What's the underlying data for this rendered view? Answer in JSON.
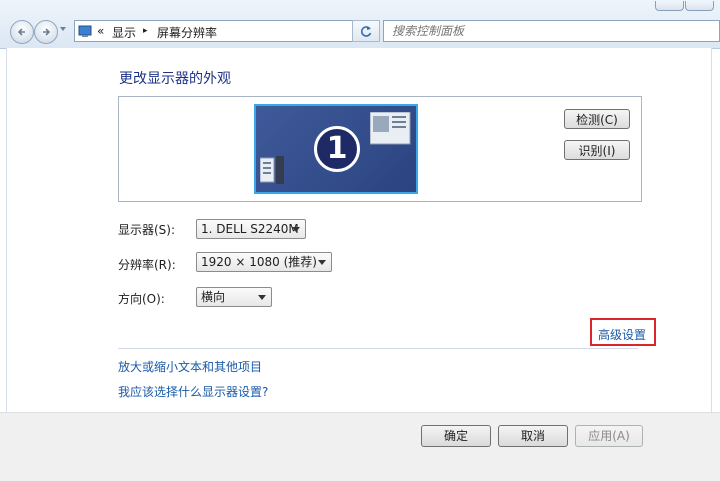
{
  "address_bar": {
    "overflow": "«",
    "crumbs": [
      "显示",
      "屏幕分辨率"
    ],
    "separator": "▸"
  },
  "search": {
    "placeholder": "搜索控制面板"
  },
  "main": {
    "title": "更改显示器的外观",
    "monitor_number": "1",
    "detect_button": "检测(C)",
    "identify_button": "识别(I)",
    "display_label": "显示器(S):",
    "display_value": "1. DELL S2240M",
    "resolution_label": "分辨率(R):",
    "resolution_value": "1920 × 1080 (推荐)",
    "orientation_label": "方向(O):",
    "orientation_value": "横向",
    "advanced_link": "高级设置",
    "links": [
      "放大或缩小文本和其他项目",
      "我应该选择什么显示器设置?"
    ]
  },
  "footer": {
    "ok": "确定",
    "cancel": "取消",
    "apply": "应用(A)"
  },
  "colors": {
    "title_blue": "#1e3287",
    "link_blue": "#1a5aa8",
    "highlight_red": "#d9262c",
    "monitor_bg": "#3f5a9a"
  }
}
